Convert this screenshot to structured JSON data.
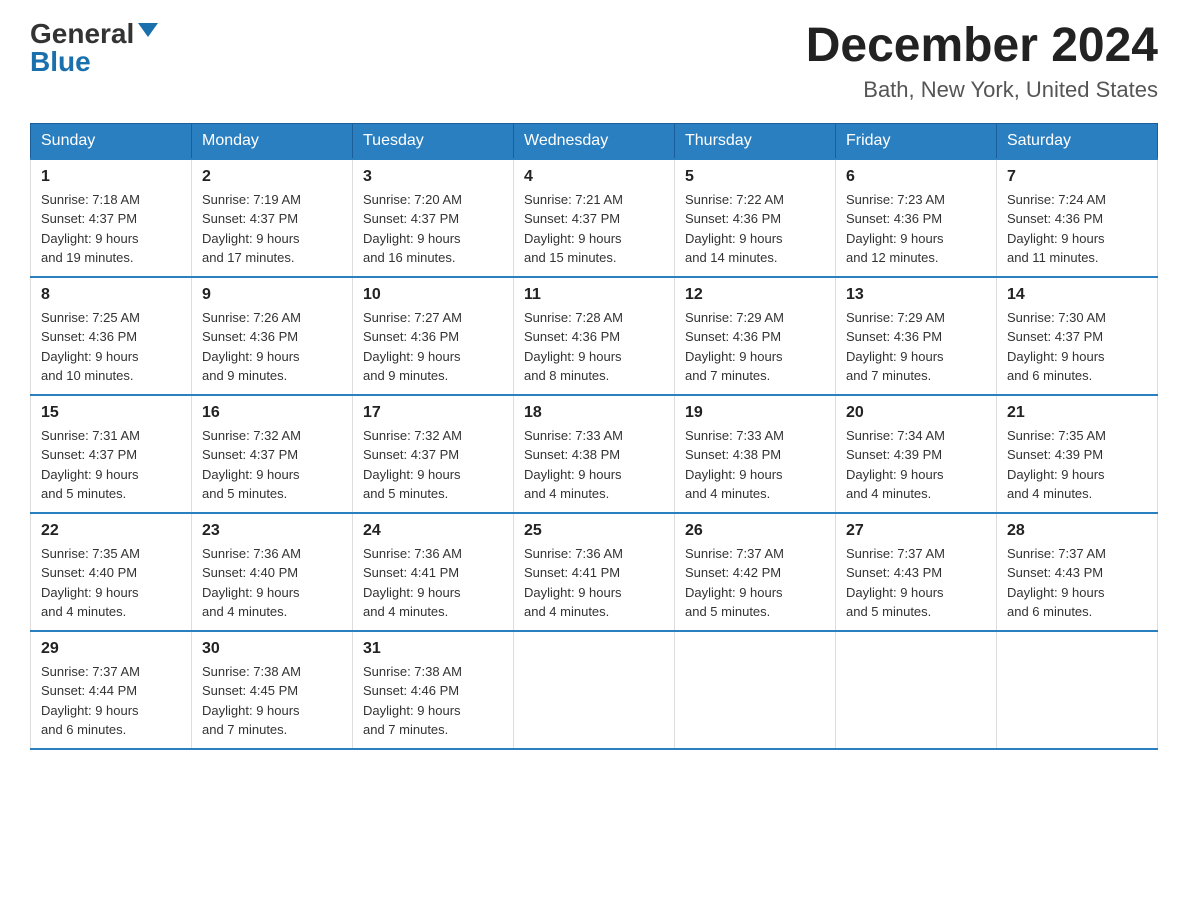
{
  "logo": {
    "general": "General",
    "blue": "Blue"
  },
  "title": {
    "month": "December 2024",
    "location": "Bath, New York, United States"
  },
  "headers": [
    "Sunday",
    "Monday",
    "Tuesday",
    "Wednesday",
    "Thursday",
    "Friday",
    "Saturday"
  ],
  "weeks": [
    [
      {
        "day": "1",
        "sunrise": "7:18 AM",
        "sunset": "4:37 PM",
        "daylight": "9 hours and 19 minutes."
      },
      {
        "day": "2",
        "sunrise": "7:19 AM",
        "sunset": "4:37 PM",
        "daylight": "9 hours and 17 minutes."
      },
      {
        "day": "3",
        "sunrise": "7:20 AM",
        "sunset": "4:37 PM",
        "daylight": "9 hours and 16 minutes."
      },
      {
        "day": "4",
        "sunrise": "7:21 AM",
        "sunset": "4:37 PM",
        "daylight": "9 hours and 15 minutes."
      },
      {
        "day": "5",
        "sunrise": "7:22 AM",
        "sunset": "4:36 PM",
        "daylight": "9 hours and 14 minutes."
      },
      {
        "day": "6",
        "sunrise": "7:23 AM",
        "sunset": "4:36 PM",
        "daylight": "9 hours and 12 minutes."
      },
      {
        "day": "7",
        "sunrise": "7:24 AM",
        "sunset": "4:36 PM",
        "daylight": "9 hours and 11 minutes."
      }
    ],
    [
      {
        "day": "8",
        "sunrise": "7:25 AM",
        "sunset": "4:36 PM",
        "daylight": "9 hours and 10 minutes."
      },
      {
        "day": "9",
        "sunrise": "7:26 AM",
        "sunset": "4:36 PM",
        "daylight": "9 hours and 9 minutes."
      },
      {
        "day": "10",
        "sunrise": "7:27 AM",
        "sunset": "4:36 PM",
        "daylight": "9 hours and 9 minutes."
      },
      {
        "day": "11",
        "sunrise": "7:28 AM",
        "sunset": "4:36 PM",
        "daylight": "9 hours and 8 minutes."
      },
      {
        "day": "12",
        "sunrise": "7:29 AM",
        "sunset": "4:36 PM",
        "daylight": "9 hours and 7 minutes."
      },
      {
        "day": "13",
        "sunrise": "7:29 AM",
        "sunset": "4:36 PM",
        "daylight": "9 hours and 7 minutes."
      },
      {
        "day": "14",
        "sunrise": "7:30 AM",
        "sunset": "4:37 PM",
        "daylight": "9 hours and 6 minutes."
      }
    ],
    [
      {
        "day": "15",
        "sunrise": "7:31 AM",
        "sunset": "4:37 PM",
        "daylight": "9 hours and 5 minutes."
      },
      {
        "day": "16",
        "sunrise": "7:32 AM",
        "sunset": "4:37 PM",
        "daylight": "9 hours and 5 minutes."
      },
      {
        "day": "17",
        "sunrise": "7:32 AM",
        "sunset": "4:37 PM",
        "daylight": "9 hours and 5 minutes."
      },
      {
        "day": "18",
        "sunrise": "7:33 AM",
        "sunset": "4:38 PM",
        "daylight": "9 hours and 4 minutes."
      },
      {
        "day": "19",
        "sunrise": "7:33 AM",
        "sunset": "4:38 PM",
        "daylight": "9 hours and 4 minutes."
      },
      {
        "day": "20",
        "sunrise": "7:34 AM",
        "sunset": "4:39 PM",
        "daylight": "9 hours and 4 minutes."
      },
      {
        "day": "21",
        "sunrise": "7:35 AM",
        "sunset": "4:39 PM",
        "daylight": "9 hours and 4 minutes."
      }
    ],
    [
      {
        "day": "22",
        "sunrise": "7:35 AM",
        "sunset": "4:40 PM",
        "daylight": "9 hours and 4 minutes."
      },
      {
        "day": "23",
        "sunrise": "7:36 AM",
        "sunset": "4:40 PM",
        "daylight": "9 hours and 4 minutes."
      },
      {
        "day": "24",
        "sunrise": "7:36 AM",
        "sunset": "4:41 PM",
        "daylight": "9 hours and 4 minutes."
      },
      {
        "day": "25",
        "sunrise": "7:36 AM",
        "sunset": "4:41 PM",
        "daylight": "9 hours and 4 minutes."
      },
      {
        "day": "26",
        "sunrise": "7:37 AM",
        "sunset": "4:42 PM",
        "daylight": "9 hours and 5 minutes."
      },
      {
        "day": "27",
        "sunrise": "7:37 AM",
        "sunset": "4:43 PM",
        "daylight": "9 hours and 5 minutes."
      },
      {
        "day": "28",
        "sunrise": "7:37 AM",
        "sunset": "4:43 PM",
        "daylight": "9 hours and 6 minutes."
      }
    ],
    [
      {
        "day": "29",
        "sunrise": "7:37 AM",
        "sunset": "4:44 PM",
        "daylight": "9 hours and 6 minutes."
      },
      {
        "day": "30",
        "sunrise": "7:38 AM",
        "sunset": "4:45 PM",
        "daylight": "9 hours and 7 minutes."
      },
      {
        "day": "31",
        "sunrise": "7:38 AM",
        "sunset": "4:46 PM",
        "daylight": "9 hours and 7 minutes."
      },
      null,
      null,
      null,
      null
    ]
  ],
  "labels": {
    "sunrise": "Sunrise:",
    "sunset": "Sunset:",
    "daylight": "Daylight:"
  }
}
